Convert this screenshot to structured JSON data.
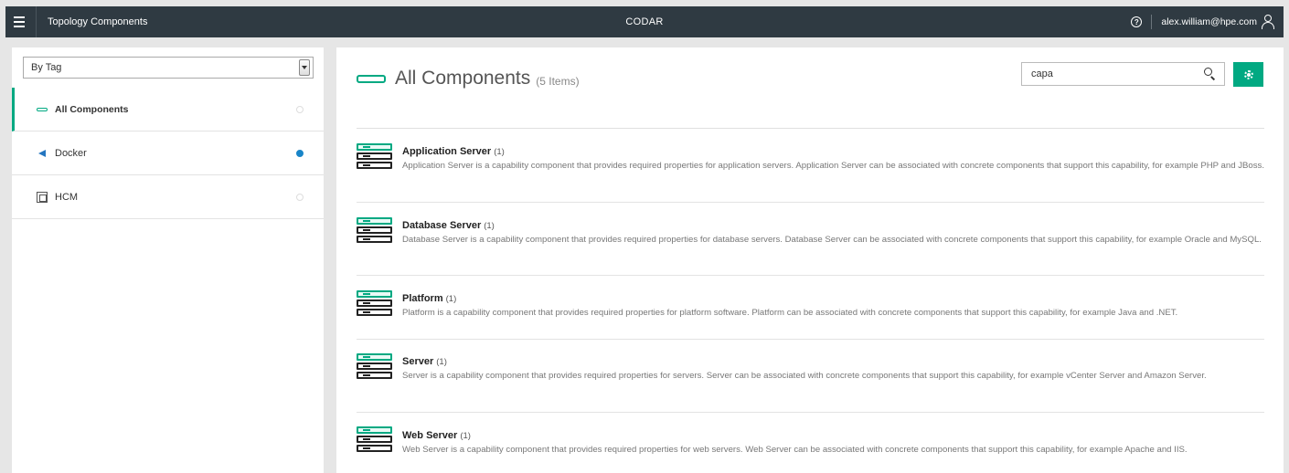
{
  "topbar": {
    "app_title": "Topology Components",
    "brand": "CODAR",
    "user_email": "alex.william@hpe.com",
    "help_glyph": "?"
  },
  "sidebar": {
    "filter_value": "By Tag",
    "tags": [
      {
        "label": "All Components",
        "icon": "component-pill-icon",
        "active": true,
        "status": "empty"
      },
      {
        "label": "Docker",
        "icon": "docker-icon",
        "active": false,
        "status": "filled"
      },
      {
        "label": "HCM",
        "icon": "hcm-icon",
        "active": false,
        "status": "empty"
      }
    ]
  },
  "main": {
    "title": "All Components",
    "count_label": "(5 Items)",
    "search_value": "capa",
    "accent_color": "#01a982",
    "components": [
      {
        "name": "Application Server",
        "count": "(1)",
        "description": "Application Server is a capability component that provides required properties for application servers. Application Server can be associated with concrete components that support this capability, for example PHP and JBoss."
      },
      {
        "name": "Database Server",
        "count": "(1)",
        "description": "Database Server is a capability component that provides required properties for database servers. Database Server can be associated with concrete components that support this capability, for example Oracle and MySQL."
      },
      {
        "name": "Platform",
        "count": "(1)",
        "description": "Platform is a capability component that provides required properties for platform software. Platform can be associated with concrete components that support this capability, for example Java and .NET."
      },
      {
        "name": "Server",
        "count": "(1)",
        "description": "Server is a capability component that provides required properties for servers. Server can be associated with concrete components that support this capability, for example vCenter Server and Amazon Server."
      },
      {
        "name": "Web Server",
        "count": "(1)",
        "description": "Web Server is a capability component that provides required properties for web servers. Web Server can be associated with concrete components that support this capability, for example Apache and IIS."
      }
    ]
  }
}
